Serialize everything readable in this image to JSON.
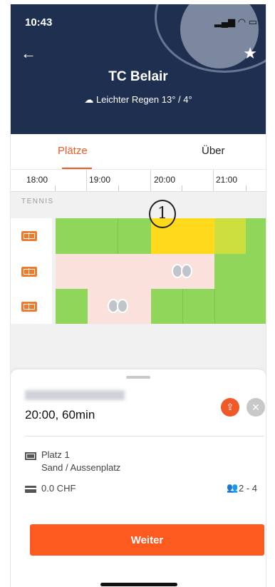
{
  "status": {
    "time": "10:43"
  },
  "header": {
    "club_name": "TC Belair",
    "weather": "Leichter Regen 13° / 4°"
  },
  "tabs": [
    {
      "label": "Plätze",
      "active": true
    },
    {
      "label": "Über",
      "active": false
    }
  ],
  "timeline": {
    "hours": [
      "18:00",
      "19:00",
      "20:00",
      "21:00"
    ]
  },
  "section": {
    "label": "TENNIS"
  },
  "annotation": {
    "marker": "1"
  },
  "booking": {
    "time_duration": "20:00, 60min",
    "court_name": "Platz 1",
    "court_type": "Sand / Aussenplatz",
    "price": "0.0 CHF",
    "players": "2 - 4",
    "continue_label": "Weiter"
  },
  "colors": {
    "accent": "#f05a28",
    "header_bg": "#1f2f50",
    "free": "#8fd65b",
    "selected": "#ffd91c",
    "booked": "#fbe1dc",
    "button": "#fd5a20"
  },
  "icons": {
    "back": "arrow-left-icon",
    "favorite": "star-icon",
    "weather": "cloud-rain-icon",
    "share": "share-icon",
    "close": "close-icon",
    "court": "court-icon",
    "price": "card-icon",
    "players": "people-icon"
  }
}
